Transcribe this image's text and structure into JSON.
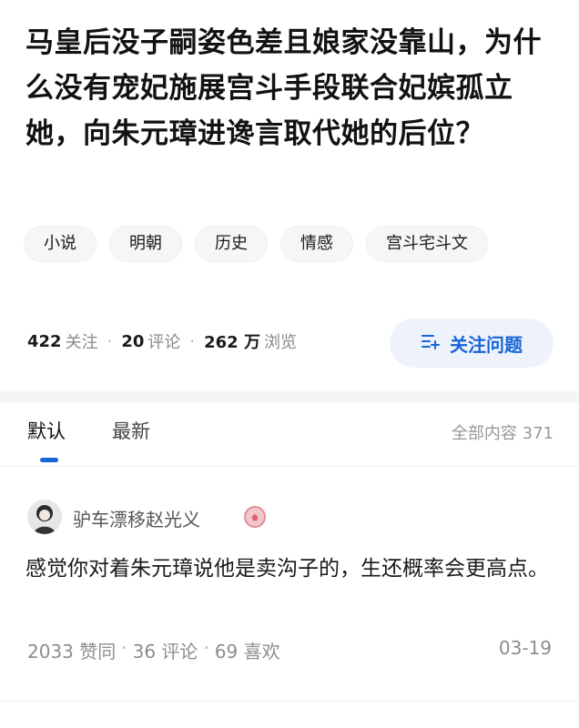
{
  "question": {
    "title": "马皇后没子嗣姿色差且娘家没靠山，为什么没有宠妃施展宫斗手段联合妃嫔孤立她，向朱元璋进谗言取代她的后位？"
  },
  "tags": [
    "小说",
    "明朝",
    "历史",
    "情感",
    "宫斗宅斗文"
  ],
  "stats": {
    "followers_count": "422",
    "followers_label": "关注",
    "comments_count": "20",
    "comments_label": "评论",
    "views_count": "262 万",
    "views_label": "浏览",
    "separator": "·"
  },
  "follow_button": {
    "label": "关注问题",
    "icon": "follow-question-icon"
  },
  "tabs": {
    "default_label": "默认",
    "latest_label": "最新",
    "all_content_label": "全部内容 371"
  },
  "answer": {
    "author": "驴车漂移赵光义",
    "author_badge_icon": "user-badge-icon",
    "content": "感觉你对着朱元璋说他是卖沟子的，生还概率会更高点。",
    "upvotes": "2033 赞同",
    "comments": "36 评论",
    "likes": "69 喜欢",
    "separator": "·",
    "date": "03-19"
  },
  "colors": {
    "accent": "#1764d6",
    "follow_button_bg": "#eef3fb",
    "muted_text": "#8d8d8d"
  }
}
